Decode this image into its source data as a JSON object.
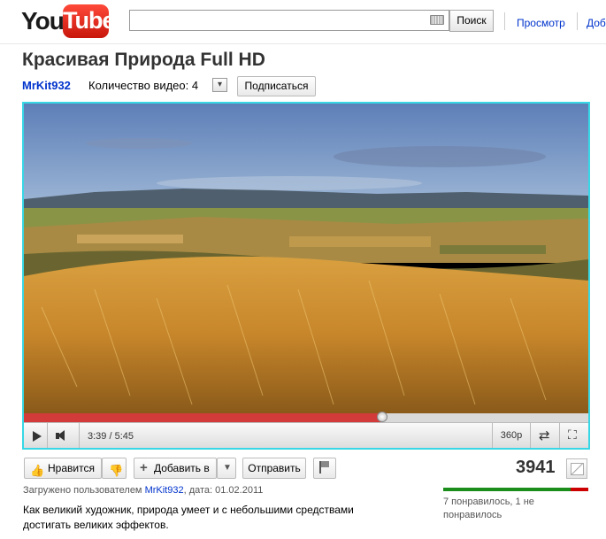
{
  "header": {
    "logo": {
      "you": "You",
      "tube": "Tube"
    },
    "search": {
      "value": "",
      "button_label": "Поиск"
    },
    "nav": {
      "browse": "Просмотр",
      "upload_partial": "Доб"
    }
  },
  "video": {
    "title": "Красивая Природа Full HD",
    "channel": "MrKit932",
    "video_count_label": "Количество видео: 4",
    "subscribe_label": "Подписаться"
  },
  "player": {
    "time": "3:39 / 5:45",
    "progress": 0.635,
    "quality": "360p"
  },
  "actions": {
    "like_label": "Нравится",
    "add_label": "Добавить в",
    "share_label": "Отправить",
    "views": "3941"
  },
  "ratings": {
    "likes_fraction": 0.875,
    "text": "7 понравилось, 1 не понравилось",
    "colors": {
      "like": "#1a8d1a",
      "dislike": "#cc0000"
    }
  },
  "meta": {
    "uploaded_prefix": "Загружено пользователем",
    "uploader": "MrKit932",
    "date_text": ", дата: 01.02.2011"
  },
  "description": "Как великий художник, природа умеет и с небольшими средствами достигать великих эффектов."
}
